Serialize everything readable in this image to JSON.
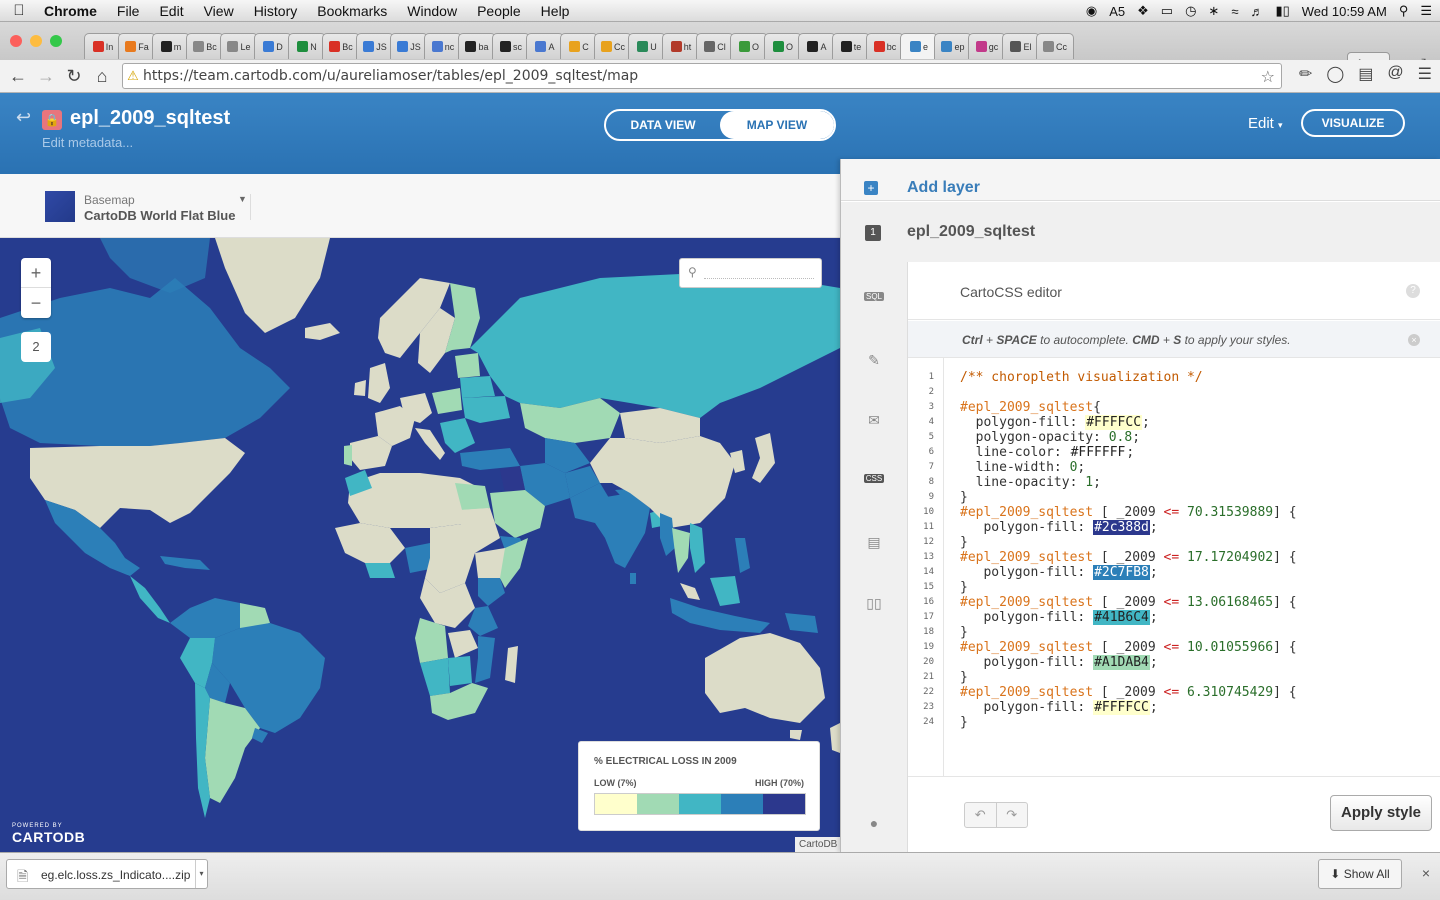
{
  "menubar": {
    "apple": "",
    "items": [
      "Chrome",
      "File",
      "Edit",
      "View",
      "History",
      "Bookmarks",
      "Window",
      "People",
      "Help"
    ],
    "status_count": "5",
    "clock": "Wed 10:59 AM"
  },
  "tabs": [
    {
      "label": "In",
      "color": "#d93025"
    },
    {
      "label": "Fa",
      "color": "#e87a1e"
    },
    {
      "label": "m",
      "color": "#222222"
    },
    {
      "label": "Bc",
      "color": "#888888"
    },
    {
      "label": "Le",
      "color": "#888888"
    },
    {
      "label": "D",
      "color": "#3a7bd5"
    },
    {
      "label": "N",
      "color": "#1e8e3e"
    },
    {
      "label": "Bc",
      "color": "#d93025"
    },
    {
      "label": "JS",
      "color": "#3a7bd5"
    },
    {
      "label": "JS",
      "color": "#3a7bd5"
    },
    {
      "label": "nc",
      "color": "#4a78d0"
    },
    {
      "label": "ba",
      "color": "#222222"
    },
    {
      "label": "sc",
      "color": "#222222"
    },
    {
      "label": "A",
      "color": "#4a78d0"
    },
    {
      "label": "C",
      "color": "#e8a21e"
    },
    {
      "label": "Cc",
      "color": "#e8a21e"
    },
    {
      "label": "U",
      "color": "#2a8a5a"
    },
    {
      "label": "ht",
      "color": "#b23a2a"
    },
    {
      "label": "Cl",
      "color": "#666666"
    },
    {
      "label": "O",
      "color": "#3a9a3a"
    },
    {
      "label": "O",
      "color": "#1e8e3e"
    },
    {
      "label": "A",
      "color": "#222222"
    },
    {
      "label": "te",
      "color": "#222222"
    },
    {
      "label": "bc",
      "color": "#d93025"
    },
    {
      "label": "e",
      "color": "#3a84c4",
      "active": true
    },
    {
      "label": "ep",
      "color": "#3a84c4"
    },
    {
      "label": "gc",
      "color": "#c23a8a"
    },
    {
      "label": "El",
      "color": "#555555"
    },
    {
      "label": "Cc",
      "color": "#888888"
    }
  ],
  "profile": "Aure",
  "url": "https://team.cartodb.com/u/aureliamoser/tables/epl_2009_sqltest/map",
  "header": {
    "table_name": "epl_2009_sqltest",
    "edit_metadata": "Edit metadata...",
    "data_view": "DATA VIEW",
    "map_view": "MAP VIEW",
    "edit_menu": "Edit",
    "visualize": "VISUALIZE"
  },
  "basemap": {
    "label": "Basemap",
    "name": "CartoDB World Flat Blue"
  },
  "map": {
    "zoom_in": "+",
    "zoom_out": "−",
    "layer_count": "2",
    "search_placeholder": "",
    "powered_by": "POWERED BY",
    "brand": "CARTODB",
    "attribution": "CartoDB"
  },
  "legend": {
    "title": "% ELECTRICAL LOSS IN 2009",
    "low": "LOW (7%)",
    "high": "HIGH (70%)",
    "colors": [
      "#FFFFCC",
      "#A1DAB4",
      "#41B6C4",
      "#2C7FB8",
      "#2C388D"
    ]
  },
  "panel": {
    "add_layer": "Add layer",
    "layer_number": "1",
    "layer_name": "epl_2009_sqltest",
    "sidebar_icons": [
      "SQL",
      "wizard",
      "infowindow",
      "CSS",
      "legend",
      "filters",
      "tooltip"
    ],
    "editor_title": "CartoCSS editor",
    "hint_ctrl": "Ctrl",
    "hint_space": "SPACE",
    "hint_mid": " to autocomplete. ",
    "hint_cmd": "CMD",
    "hint_s": "S",
    "hint_end": " to apply your styles.",
    "apply": "Apply style"
  },
  "code_lines": [
    "/** choropleth visualization */",
    "",
    "#epl_2009_sqltest{",
    "  polygon-fill: #FFFFCC;",
    "  polygon-opacity: 0.8;",
    "  line-color: #FFFFFF;",
    "  line-width: 0;",
    "  line-opacity: 1;",
    "}",
    "#epl_2009_sqltest [ _2009 <= 70.31539889] {",
    "   polygon-fill: #2c388d;",
    "}",
    "#epl_2009_sqltest [ _2009 <= 17.17204902] {",
    "   polygon-fill: #2C7FB8;",
    "}",
    "#epl_2009_sqltest [ _2009 <= 13.06168465] {",
    "   polygon-fill: #41B6C4;",
    "}",
    "#epl_2009_sqltest [ _2009 <= 10.01055966] {",
    "   polygon-fill: #A1DAB4;",
    "}",
    "#epl_2009_sqltest [ _2009 <= 6.310745429] {",
    "   polygon-fill: #FFFFCC;",
    "}"
  ],
  "download": {
    "filename": "eg.elc.loss.zs_Indicato....zip",
    "show_all": "Show All"
  }
}
